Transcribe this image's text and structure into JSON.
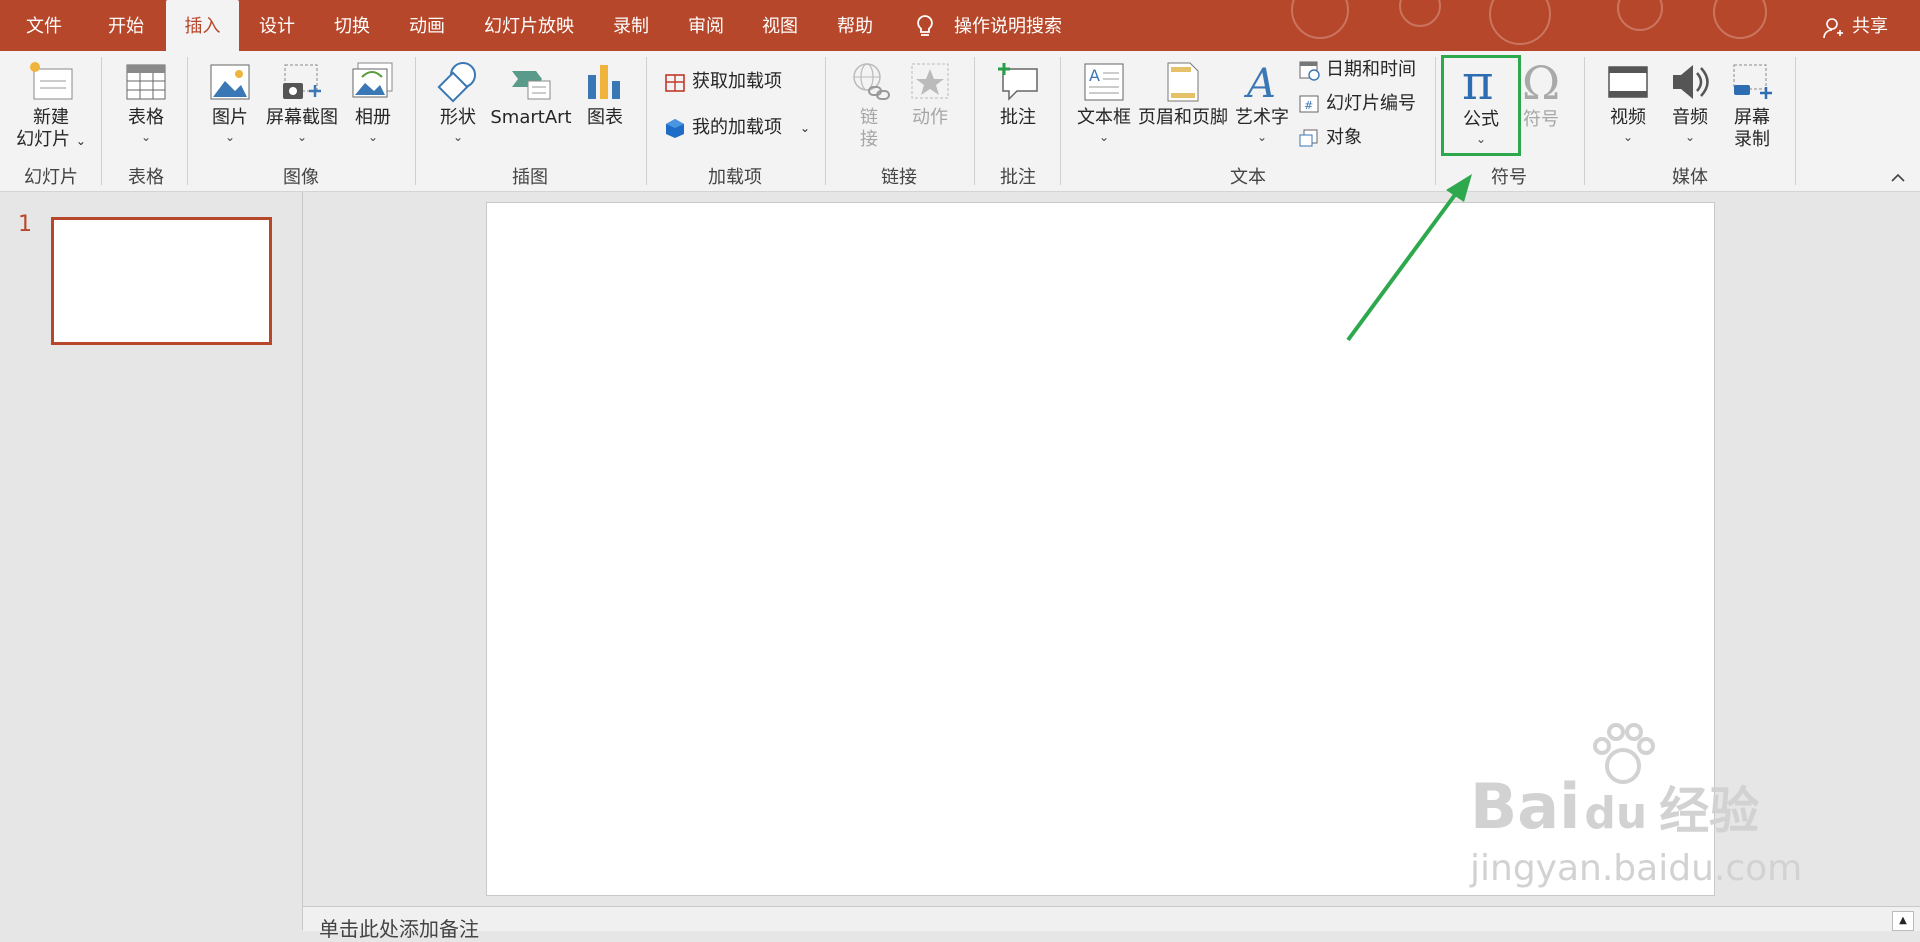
{
  "tabs": [
    "文件",
    "开始",
    "插入",
    "设计",
    "切换",
    "动画",
    "幻灯片放映",
    "录制",
    "审阅",
    "视图",
    "帮助"
  ],
  "search_label": "操作说明搜索",
  "share_label": "共享",
  "ribbon": {
    "new_slide_line1": "新建",
    "new_slide_line2": "幻灯片",
    "table": "表格",
    "picture": "图片",
    "screenshot": "屏幕截图",
    "album": "相册",
    "shapes": "形状",
    "smartart": "SmartArt",
    "chart": "图表",
    "get_addins": "获取加载项",
    "my_addins": "我的加载项",
    "link_1": "链",
    "link_2": "接",
    "action": "动作",
    "comment": "批注",
    "textbox": "文本框",
    "header_footer": "页眉和页脚",
    "wordart": "艺术字",
    "datetime": "日期和时间",
    "slide_number": "幻灯片编号",
    "object": "对象",
    "equation": "公式",
    "symbol": "符号",
    "video": "视频",
    "audio": "音频",
    "screen_record_1": "屏幕",
    "screen_record_2": "录制",
    "groups": {
      "slides": "幻灯片",
      "tables": "表格",
      "images": "图像",
      "illustrations": "插图",
      "addins": "加载项",
      "links": "链接",
      "comments": "批注",
      "text": "文本",
      "symbols": "符号",
      "media": "媒体"
    }
  },
  "thumbnail_number": "1",
  "notes_placeholder": "单击此处添加备注",
  "watermark": {
    "logo": "Bai",
    "logo2": "du",
    "cn": "经验",
    "url": "jingyan.baidu.com"
  },
  "colors": {
    "accent": "#b7472a",
    "highlight": "#2ea84d"
  }
}
